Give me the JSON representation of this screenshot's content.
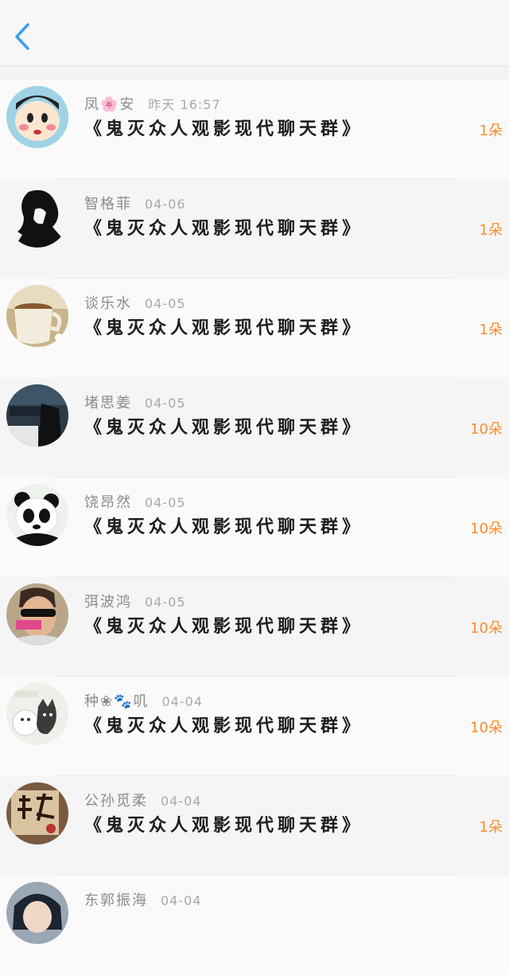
{
  "header": {
    "back_icon": "chevron-left-icon",
    "accent": "#3aa0e6"
  },
  "items": [
    {
      "name": "凤🌸安",
      "time": "昨天 16:57",
      "message": "《鬼灭众人观影现代聊天群》",
      "count": "1朵",
      "avatar_desc": "cartoon boy"
    },
    {
      "name": "智格菲",
      "time": "04-06",
      "message": "《鬼灭众人观影现代聊天群》",
      "count": "1朵",
      "avatar_desc": "silhouette"
    },
    {
      "name": "谈乐水",
      "time": "04-05",
      "message": "《鬼灭众人观影现代聊天群》",
      "count": "1朵",
      "avatar_desc": "coffee cup"
    },
    {
      "name": "堵思姜",
      "time": "04-05",
      "message": "《鬼灭众人观影现代聊天群》",
      "count": "10朵",
      "avatar_desc": "scp poster"
    },
    {
      "name": "饶昂然",
      "time": "04-05",
      "message": "《鬼灭众人观影现代聊天群》",
      "count": "10朵",
      "avatar_desc": "panda"
    },
    {
      "name": "弭波鸿",
      "time": "04-05",
      "message": "《鬼灭众人观影现代聊天群》",
      "count": "10朵",
      "avatar_desc": "man with sunglasses"
    },
    {
      "name": "种❀🐾叽",
      "time": "04-04",
      "message": "《鬼灭众人观影现代聊天群》",
      "count": "10朵",
      "avatar_desc": "cartoon cat"
    },
    {
      "name": "公孙觅柔",
      "time": "04-04",
      "message": "《鬼灭众人观影现代聊天群》",
      "count": "1朵",
      "avatar_desc": "calligraphy"
    },
    {
      "name": "东郭振海",
      "time": "04-04",
      "message": "",
      "count": "",
      "avatar_desc": "anime character"
    }
  ]
}
